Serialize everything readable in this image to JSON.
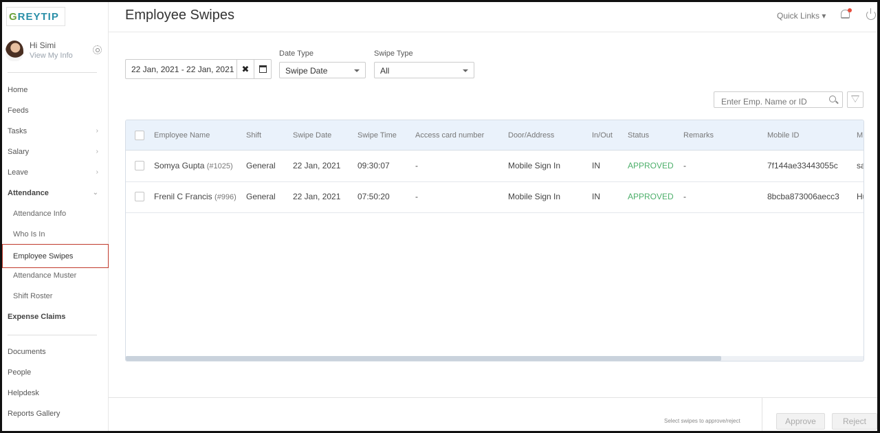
{
  "app": {
    "logo_text_prefix": "G",
    "logo_text_rest": "REYTIP",
    "page_title": "Employee Swipes",
    "quick_links_label": "Quick Links ▾"
  },
  "user": {
    "greeting": "Hi Simi",
    "view_info_label": "View My Info"
  },
  "sidebar": {
    "items": [
      {
        "label": "Home"
      },
      {
        "label": "Feeds"
      },
      {
        "label": "Tasks",
        "chevron": "›"
      },
      {
        "label": "Salary",
        "chevron": "›"
      },
      {
        "label": "Leave",
        "chevron": "›"
      },
      {
        "label": "Attendance",
        "chevron": "⌄"
      },
      {
        "label": "Attendance Info"
      },
      {
        "label": "Who Is In"
      },
      {
        "label": "Employee Swipes"
      },
      {
        "label": "Attendance Muster"
      },
      {
        "label": "Shift Roster"
      },
      {
        "label": "Expense Claims"
      },
      {
        "label": "Documents"
      },
      {
        "label": "People"
      },
      {
        "label": "Helpdesk"
      },
      {
        "label": "Reports Gallery"
      }
    ]
  },
  "filters": {
    "date_range_value": "22 Jan, 2021 - 22 Jan, 2021",
    "clear_icon": "✖",
    "date_type_label": "Date Type",
    "date_type_value": "Swipe Date",
    "swipe_type_label": "Swipe Type",
    "swipe_type_value": "All",
    "search_placeholder": "Enter Emp. Name or ID"
  },
  "table": {
    "columns": [
      "Employee Name",
      "Shift",
      "Swipe Date",
      "Swipe Time",
      "Access card number",
      "Door/Address",
      "In/Out",
      "Status",
      "Remarks",
      "Mobile ID",
      "M"
    ],
    "rows": [
      {
        "name": "Somya Gupta",
        "emp_id": "(#1025)",
        "shift": "General",
        "swipe_date": "22 Jan, 2021",
        "swipe_time": "09:30:07",
        "access_card": "-",
        "door": "Mobile Sign In",
        "in_out": "IN",
        "status": "APPROVED",
        "remarks": "-",
        "mobile_id": "7f144ae33443055c",
        "more": "sa"
      },
      {
        "name": "Frenil C Francis",
        "emp_id": "(#996)",
        "shift": "General",
        "swipe_date": "22 Jan, 2021",
        "swipe_time": "07:50:20",
        "access_card": "-",
        "door": "Mobile Sign In",
        "in_out": "IN",
        "status": "APPROVED",
        "remarks": "-",
        "mobile_id": "8bcba873006aecc3",
        "more": "Hu"
      }
    ]
  },
  "footer": {
    "hint": "Select swipes to approve/reject",
    "approve_label": "Approve",
    "reject_label": "Reject"
  },
  "colors": {
    "status_approved": "#4caf6a",
    "header_bg": "#eaf2fb",
    "active_nav_border": "#c0392b"
  }
}
